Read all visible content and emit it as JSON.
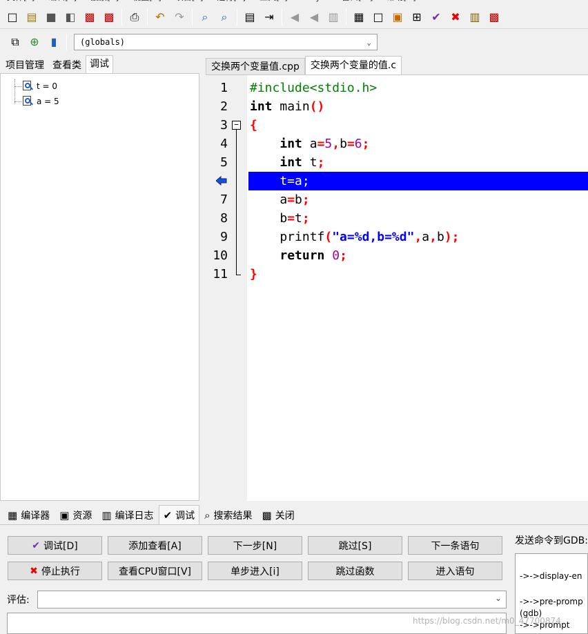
{
  "menubar": {
    "items": [
      "文件[F]",
      "编辑[E]",
      "搜索[S]",
      "视图[V]",
      "项目[P]",
      "运行[R]",
      "工具[T]",
      "AStyle",
      "窗口[W]",
      "帮助[H]"
    ]
  },
  "toolbar1": {
    "icons": [
      "new-file-icon",
      "open-file-icon",
      "save-icon",
      "save-all-icon",
      "close-icon",
      "close-all-icon",
      "print-icon",
      "undo-icon",
      "redo-icon",
      "find-icon",
      "replace-icon",
      "indent-icon",
      "unindent-icon",
      "bookmark-icon",
      "bookmark-next-icon",
      "comment-icon",
      "project-icon",
      "new-window-icon",
      "color-icon",
      "grid-icon",
      "check-icon",
      "cross-icon",
      "chart-icon",
      "profile-icon"
    ]
  },
  "toolbar2": {
    "globals_value": "(globals)"
  },
  "left": {
    "tabs": [
      "项目管理",
      "查看类",
      "调试"
    ],
    "active_tab": "调试",
    "watches": [
      "t = 0",
      "a = 5"
    ]
  },
  "editor": {
    "tabs": [
      "交换两个变量值.cpp",
      "交换两个变量的值.c"
    ],
    "active_tab": "交换两个变量的值.c",
    "current_line": 6,
    "lines": [
      {
        "n": "1",
        "tokens": [
          {
            "t": "#include<stdio.h>",
            "c": "pp"
          }
        ]
      },
      {
        "n": "2",
        "tokens": [
          {
            "t": "int",
            "c": "kw"
          },
          {
            "t": " main",
            "c": ""
          },
          {
            "t": "()",
            "c": "sym"
          }
        ]
      },
      {
        "n": "3",
        "tokens": [
          {
            "t": "{",
            "c": "sym"
          }
        ]
      },
      {
        "n": "4",
        "tokens": [
          {
            "t": "    ",
            "c": ""
          },
          {
            "t": "int",
            "c": "kw"
          },
          {
            "t": " a",
            "c": ""
          },
          {
            "t": "=",
            "c": "sym"
          },
          {
            "t": "5",
            "c": "num"
          },
          {
            "t": ",",
            "c": "sym"
          },
          {
            "t": "b",
            "c": ""
          },
          {
            "t": "=",
            "c": "sym"
          },
          {
            "t": "6",
            "c": "num"
          },
          {
            "t": ";",
            "c": "sym"
          }
        ]
      },
      {
        "n": "5",
        "tokens": [
          {
            "t": "    ",
            "c": ""
          },
          {
            "t": "int",
            "c": "kw"
          },
          {
            "t": " t",
            "c": ""
          },
          {
            "t": ";",
            "c": "sym"
          }
        ]
      },
      {
        "n": "6",
        "tokens": [
          {
            "t": "    t=a;",
            "c": ""
          }
        ]
      },
      {
        "n": "7",
        "tokens": [
          {
            "t": "    a",
            "c": ""
          },
          {
            "t": "=",
            "c": "sym"
          },
          {
            "t": "b",
            "c": ""
          },
          {
            "t": ";",
            "c": "sym"
          }
        ]
      },
      {
        "n": "8",
        "tokens": [
          {
            "t": "    b",
            "c": ""
          },
          {
            "t": "=",
            "c": "sym"
          },
          {
            "t": "t",
            "c": ""
          },
          {
            "t": ";",
            "c": "sym"
          }
        ]
      },
      {
        "n": "9",
        "tokens": [
          {
            "t": "    printf",
            "c": ""
          },
          {
            "t": "(",
            "c": "sym"
          },
          {
            "t": "\"a=%d,b=%d\"",
            "c": "str"
          },
          {
            "t": ",",
            "c": "sym"
          },
          {
            "t": "a",
            "c": ""
          },
          {
            "t": ",",
            "c": "sym"
          },
          {
            "t": "b",
            "c": ""
          },
          {
            "t": ");",
            "c": "sym"
          }
        ]
      },
      {
        "n": "10",
        "tokens": [
          {
            "t": "    ",
            "c": ""
          },
          {
            "t": "return",
            "c": "kw"
          },
          {
            "t": " ",
            "c": ""
          },
          {
            "t": "0",
            "c": "num"
          },
          {
            "t": ";",
            "c": "sym"
          }
        ]
      },
      {
        "n": "11",
        "tokens": [
          {
            "t": "}",
            "c": "sym"
          }
        ]
      }
    ]
  },
  "bottom_tabs": [
    {
      "label": "编译器",
      "icon": "grid-icon",
      "glyph": "▦"
    },
    {
      "label": "资源",
      "icon": "resource-icon",
      "glyph": "▣"
    },
    {
      "label": "编译日志",
      "icon": "chart-icon",
      "glyph": "▥"
    },
    {
      "label": "调试",
      "icon": "check-icon",
      "glyph": "✔",
      "active": true
    },
    {
      "label": "搜索结果",
      "icon": "find-icon",
      "glyph": "⌕"
    },
    {
      "label": "关闭",
      "icon": "close-icon",
      "glyph": "▩"
    }
  ],
  "debug": {
    "buttons_row1": [
      "调试[D]",
      "添加查看[A]",
      "下一步[N]",
      "跳过[S]",
      "下一条语句"
    ],
    "buttons_row2": [
      "停止执行",
      "查看CPU窗口[V]",
      "单步进入[i]",
      "跳过函数",
      "进入语句"
    ],
    "eval_label": "评估:",
    "eval_value": "",
    "gdb_label": "发送命令到GDB:",
    "gdb_lines": [
      "->->display-en",
      "->->pre-promp",
      "(gdb)",
      "->->prompt"
    ]
  },
  "watermark": "https://blog.csdn.net/m0_47700874",
  "colors": {
    "highlight_line": "#0000ff",
    "keyword": "#000000",
    "preprocessor": "#008000",
    "number": "#a000a0",
    "symbol": "#ff0000",
    "string": "#0000ff"
  }
}
